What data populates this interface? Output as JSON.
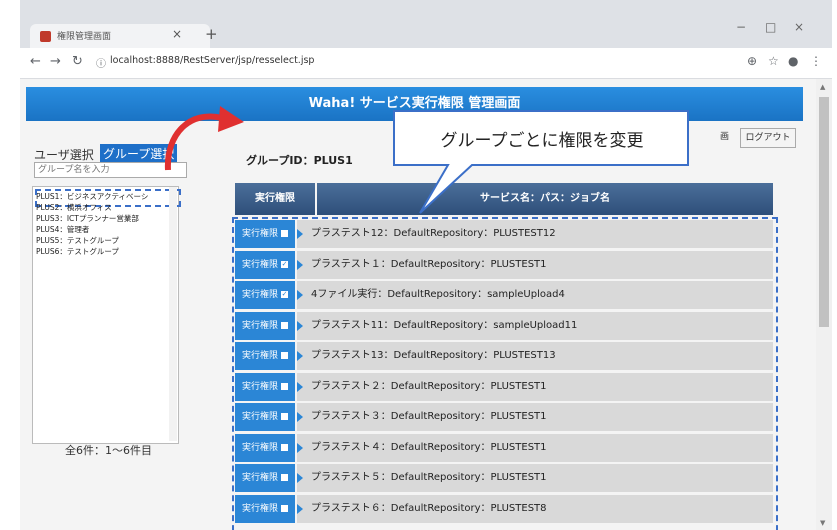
{
  "browser": {
    "tab_title": "権限管理画面",
    "tab_close": "×",
    "new_tab": "+",
    "url": "localhost:8888/RestServer/jsp/resselect.jsp",
    "win_min": "−",
    "win_max": "□",
    "win_close": "×"
  },
  "header": {
    "title": "Waha! サービス実行権限 管理画面"
  },
  "left_panel": {
    "tab_user": "ユーザ選択",
    "tab_group": "グループ選択",
    "search_placeholder": "グループ名を入力",
    "groups": [
      "PLUS1：ビジネスアクティベーシ",
      "PLUS2：横浜オフィス",
      "PLUS3：ICTプランナー営業部",
      "PLUS4：管理者",
      "PLUS5：テストグループ",
      "PLUS6：テストグループ"
    ],
    "count": "全6件：1〜6件目"
  },
  "main": {
    "group_id": "グループID：PLUS1",
    "callout": "グループごとに権限を変更",
    "logout": "ログアウト",
    "partial_button": "画",
    "col_perm": "実行権限",
    "col_service": "サービス名：パス：ジョブ名",
    "perm_label": "実行権限",
    "rows": [
      {
        "checked": false,
        "text": "プラステスト12：DefaultRepository：PLUSTEST12"
      },
      {
        "checked": true,
        "text": "プラステスト１：DefaultRepository：PLUSTEST1"
      },
      {
        "checked": true,
        "text": "4ファイル実行：DefaultRepository：sampleUpload4"
      },
      {
        "checked": false,
        "text": "プラステスト11：DefaultRepository：sampleUpload11"
      },
      {
        "checked": false,
        "text": "プラステスト13：DefaultRepository：PLUSTEST13"
      },
      {
        "checked": false,
        "text": "プラステスト２：DefaultRepository：PLUSTEST1"
      },
      {
        "checked": false,
        "text": "プラステスト３：DefaultRepository：PLUSTEST1"
      },
      {
        "checked": false,
        "text": "プラステスト４：DefaultRepository：PLUSTEST1"
      },
      {
        "checked": false,
        "text": "プラステスト５：DefaultRepository：PLUSTEST1"
      },
      {
        "checked": false,
        "text": "プラステスト６：DefaultRepository：PLUSTEST8"
      }
    ]
  },
  "colors": {
    "header": "#1a73c4",
    "perm_cell": "#2b86d6",
    "service_cell": "#d9d9d9",
    "callout_border": "#3b6fc8",
    "arrow": "#e03030"
  }
}
